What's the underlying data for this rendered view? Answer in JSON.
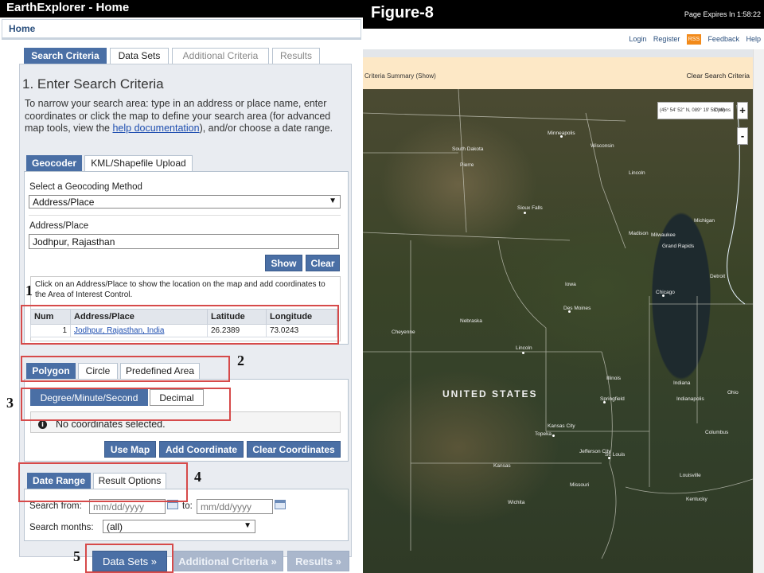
{
  "left": {
    "window_title": "EarthExplorer - Home",
    "home_link": "Home",
    "main_tabs": [
      {
        "label": "Search Criteria"
      },
      {
        "label": "Data Sets"
      },
      {
        "label": "Additional Criteria"
      },
      {
        "label": "Results"
      }
    ],
    "heading": "1. Enter Search Criteria",
    "intro_before": "To narrow your search area: type in an address or place name, enter coordinates or click the map to define your search area (for advanced map tools, view the ",
    "intro_link": "help documentation",
    "intro_after": "), and/or choose a date range.",
    "geo_tabs": [
      {
        "label": "Geocoder"
      },
      {
        "label": "KML/Shapefile Upload"
      }
    ],
    "method_label": "Select a Geocoding Method",
    "method_value": "Address/Place",
    "address_label": "Address/Place",
    "address_value": "Jodhpur, Rajasthan",
    "show_button": "Show",
    "clear_button": "Clear",
    "results_help": "Click on an Address/Place to show the location on the map and add coordinates to the Area of Interest Control.",
    "table": {
      "headers": [
        "Num",
        "Address/Place",
        "Latitude",
        "Longitude"
      ],
      "rows": [
        [
          "1",
          "Jodhpur, Rajasthan, India",
          "26.2389",
          "73.0243"
        ]
      ]
    },
    "area_tabs": [
      {
        "label": "Polygon"
      },
      {
        "label": "Circle"
      },
      {
        "label": "Predefined Area"
      }
    ],
    "coord_tabs": [
      {
        "label": "Degree/Minute/Second"
      },
      {
        "label": "Decimal"
      }
    ],
    "info_icon_glyph": "i",
    "no_coords": "No coordinates selected.",
    "use_map_button": "Use Map",
    "add_coord_button": "Add Coordinate",
    "clear_coords_button": "Clear Coordinates",
    "date_tabs": [
      {
        "label": "Date Range"
      },
      {
        "label": "Result Options"
      }
    ],
    "search_from_label": "Search from:",
    "date_placeholder": "mm/dd/yyyy",
    "to_label": "to:",
    "search_months_label": "Search months:",
    "months_value": "(all)",
    "datasets_button": "Data Sets »",
    "additional_button": "Additional Criteria »",
    "results_button": "Results »",
    "annotations": [
      "1",
      "2",
      "3",
      "4",
      "5"
    ]
  },
  "right": {
    "figure_title": "Figure-8",
    "page_expires": "Page Expires In 1:58:22",
    "nav": [
      "Login",
      "Register",
      "Feedback",
      "Help"
    ],
    "rss_label": "RSS",
    "summary_left": "Criteria Summary (Show)",
    "summary_right": "Clear Search Criteria",
    "coord_readout": "(45° 54' 52\" N, 089° 19' 58\" W)",
    "coord_options": "Options",
    "zoom_in": "+",
    "zoom_out": "-",
    "map_labels": {
      "country": "UNITED STATES",
      "places": [
        "Minneapolis",
        "Wisconsin",
        "South Dakota",
        "Pierre",
        "Sioux Falls",
        "Madison",
        "Milwaukee",
        "Grand Rapids",
        "Michigan",
        "Detroit",
        "Chicago",
        "Iowa",
        "Des Moines",
        "Nebraska",
        "Lincoln",
        "Cheyenne",
        "Illinois",
        "Springfield",
        "Indiana",
        "Indianapolis",
        "Ohio",
        "Columbus",
        "Topeka",
        "Kansas City",
        "Jefferson City",
        "St. Louis",
        "Kansas",
        "Missouri",
        "Wichita",
        "Louisville",
        "Kentucky",
        "Mich",
        "Wisconsin"
      ]
    }
  }
}
